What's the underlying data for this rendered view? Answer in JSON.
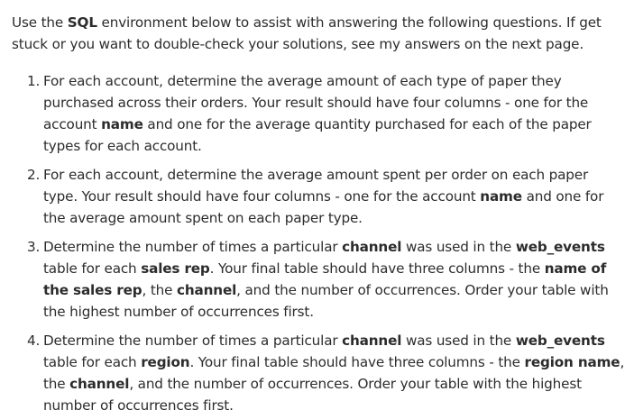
{
  "intro": [
    {
      "t": "Use the ",
      "b": false
    },
    {
      "t": "SQL",
      "b": true
    },
    {
      "t": " environment below to assist with answering the following questions. If get stuck or you want to double-check your solutions, see my answers on the next page.",
      "b": false
    }
  ],
  "questions": [
    {
      "number": "1.",
      "segments": [
        {
          "t": "For each account, determine the average amount of each type of paper they purchased across their orders. Your result should have four columns - one for the account ",
          "b": false
        },
        {
          "t": "name",
          "b": true
        },
        {
          "t": " and one for the average quantity purchased for each of the paper types for each account.",
          "b": false
        }
      ]
    },
    {
      "number": "2.",
      "segments": [
        {
          "t": "For each account, determine the average amount spent per order on each paper type. Your result should have four columns - one for the account ",
          "b": false
        },
        {
          "t": "name",
          "b": true
        },
        {
          "t": " and one for the average amount spent on each paper type.",
          "b": false
        }
      ]
    },
    {
      "number": "3.",
      "segments": [
        {
          "t": "Determine the number of times a particular ",
          "b": false
        },
        {
          "t": "channel",
          "b": true
        },
        {
          "t": " was used in the ",
          "b": false
        },
        {
          "t": "web_events",
          "b": true
        },
        {
          "t": " table for each ",
          "b": false
        },
        {
          "t": "sales rep",
          "b": true
        },
        {
          "t": ". Your final table should have three columns - the ",
          "b": false
        },
        {
          "t": "name of the sales rep",
          "b": true
        },
        {
          "t": ", the ",
          "b": false
        },
        {
          "t": "channel",
          "b": true
        },
        {
          "t": ", and the number of occurrences. Order your table with the highest number of occurrences first.",
          "b": false
        }
      ]
    },
    {
      "number": "4.",
      "segments": [
        {
          "t": "Determine the number of times a particular ",
          "b": false
        },
        {
          "t": "channel",
          "b": true
        },
        {
          "t": " was used in the ",
          "b": false
        },
        {
          "t": "web_events",
          "b": true
        },
        {
          "t": " table for each ",
          "b": false
        },
        {
          "t": "region",
          "b": true
        },
        {
          "t": ". Your final table should have three columns - the ",
          "b": false
        },
        {
          "t": "region name",
          "b": true
        },
        {
          "t": ", the ",
          "b": false
        },
        {
          "t": "channel",
          "b": true
        },
        {
          "t": ", and the number of occurrences. Order your table with the highest number of occurrences first.",
          "b": false
        }
      ]
    }
  ]
}
